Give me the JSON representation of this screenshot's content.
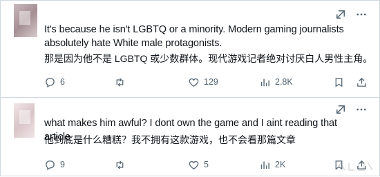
{
  "posts": [
    {
      "text_en": "It's because he isn't LGBTQ or a minority. Modern gaming journalists absolutely hate White male protagonists.",
      "text_zh": "那是因为他不是 LGBTQ 或少数群体。现代游戏记者绝对讨厌白人男性主角。",
      "replies": "6",
      "retweets": "",
      "likes": "129",
      "views": "2.8K"
    },
    {
      "text_en": "what makes him awful? I dont own the game and I aint reading that article",
      "text_zh": "他到底是什么糟糕？我不拥有这款游戏，也不会看那篇文章",
      "replies": "9",
      "retweets": "",
      "likes": "5",
      "views": "2K"
    }
  ],
  "icons": {
    "grok": "grok-icon",
    "more": "more-icon",
    "reply": "reply-icon",
    "retweet": "retweet-icon",
    "like": "like-icon",
    "views": "views-icon",
    "bookmark": "bookmark-icon",
    "share": "share-icon"
  },
  "colors": {
    "text": "#0f1419",
    "muted": "#536471",
    "border": "#cfd9de"
  }
}
